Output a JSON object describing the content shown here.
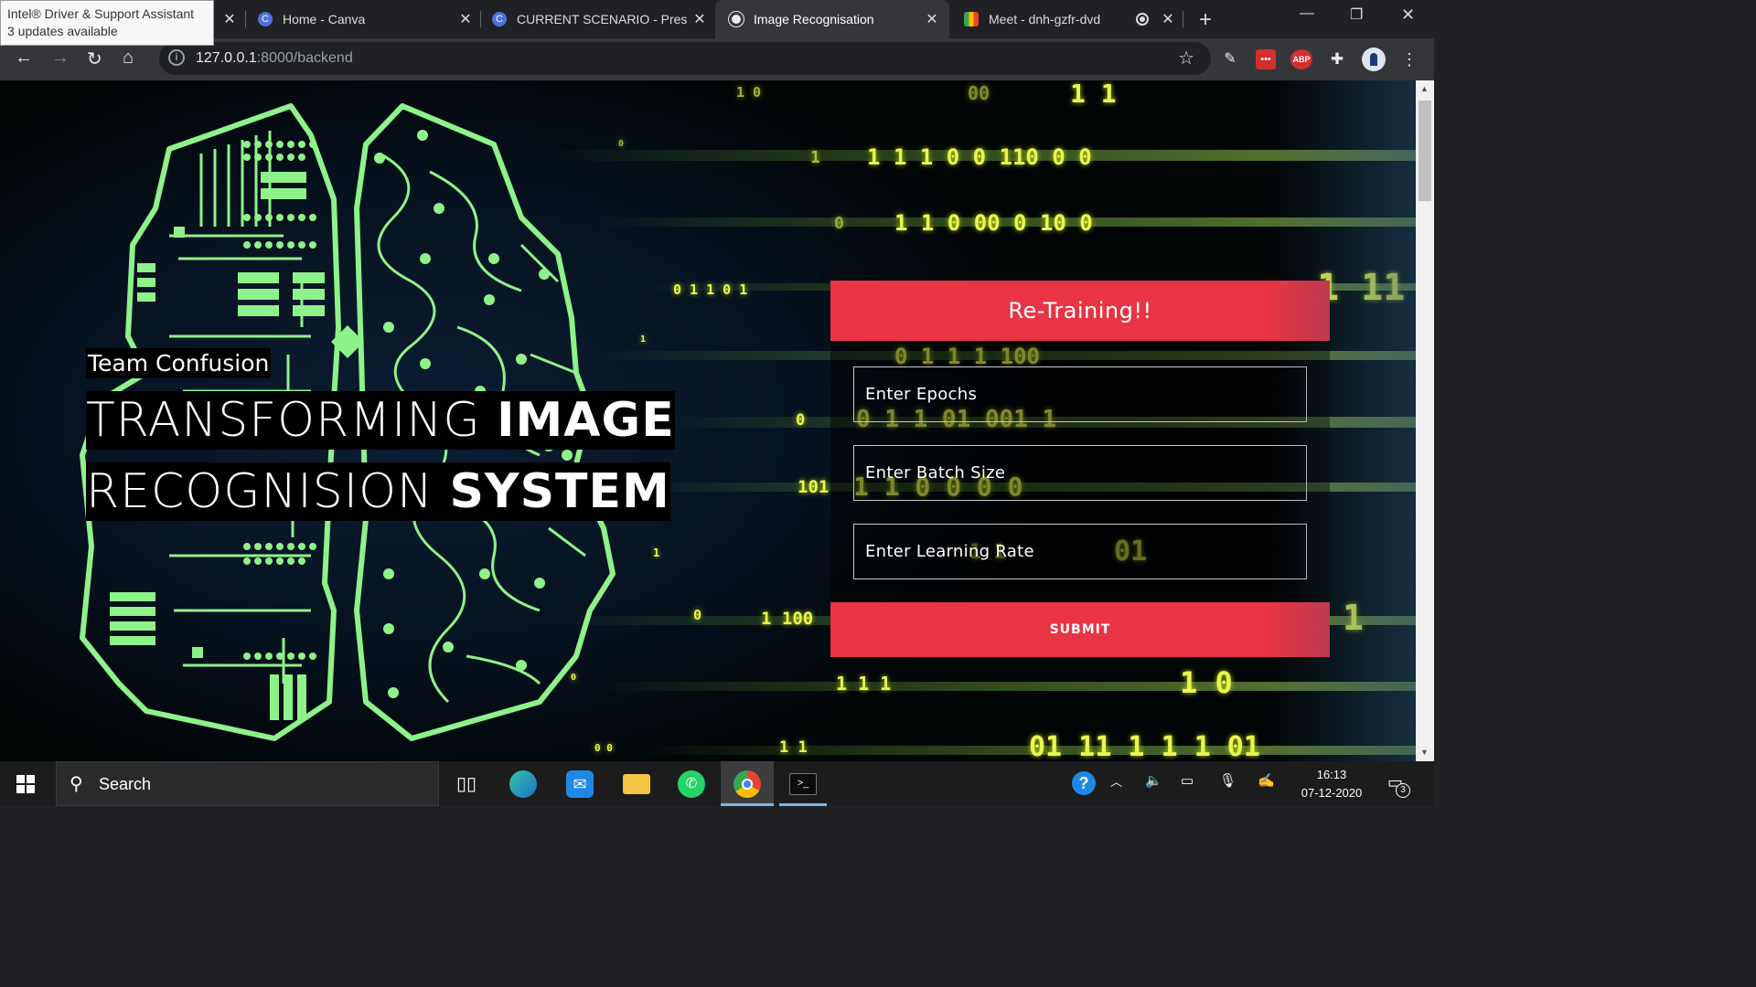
{
  "notification": {
    "line1": "Intel® Driver & Support Assistant",
    "line2": "3 updates available"
  },
  "tabs": [
    {
      "title": "Home - Canva",
      "icon": "canva-icon",
      "active": false
    },
    {
      "title": "CURRENT SCENARIO - Pres",
      "icon": "canva-icon",
      "active": false
    },
    {
      "title": "Image Recognisation",
      "icon": "globe-icon",
      "active": true
    },
    {
      "title": "Meet - dnh-gzfr-dvd",
      "icon": "google-meet-icon",
      "active": false
    }
  ],
  "address_bar": {
    "host": "127.0.0.1",
    "path": ":8000/backend"
  },
  "extensions": {
    "adblock_label": "ABP",
    "dots_label": "•••"
  },
  "page": {
    "team_name": "Team Confusion",
    "headline_line1_light": "TRANSFORMING ",
    "headline_line1_bold": "IMAGE",
    "headline_line2_light": "RECOGNISION ",
    "headline_line2_bold": "SYSTEM",
    "retrain_label": "Re-Training!!",
    "form": {
      "epochs_placeholder": "Enter Epochs",
      "epochs_value": "",
      "batch_placeholder": "Enter Batch Size",
      "batch_value": "",
      "lr_placeholder": "Enter Learning Rate",
      "lr_value": "",
      "submit_label": "SUBMIT"
    }
  },
  "taskbar": {
    "search_placeholder": "Search",
    "apps": [
      "task-view-icon",
      "edge-icon",
      "mail-icon",
      "file-explorer-icon",
      "whatsapp-icon",
      "chrome-icon",
      "terminal-icon"
    ],
    "clock_time": "16:13",
    "clock_date": "07-12-2020",
    "notification_count": "3"
  },
  "colors": {
    "accent_red": "#e83444",
    "binary_yellow": "#e8f556",
    "brain_green": "#8ef28a"
  }
}
